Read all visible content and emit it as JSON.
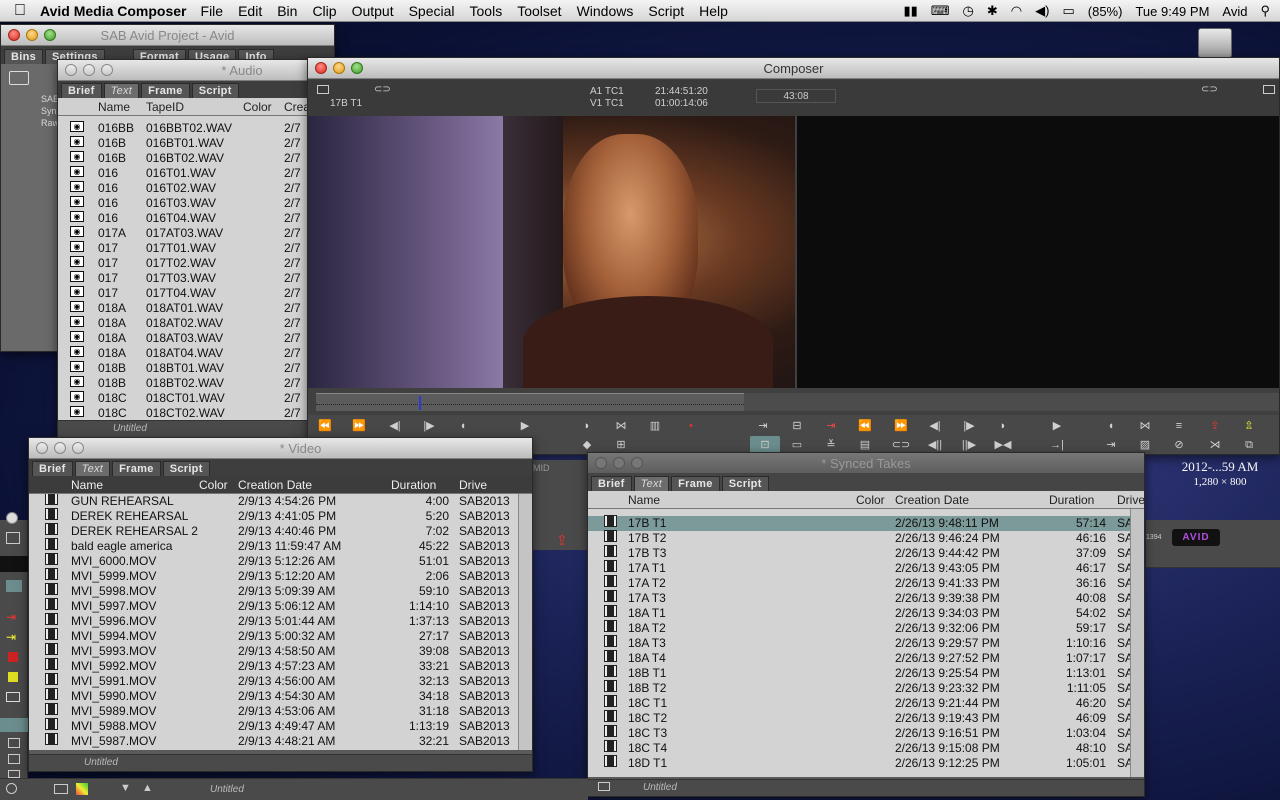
{
  "menubar": {
    "app_name": "Avid Media Composer",
    "menus": [
      "File",
      "Edit",
      "Bin",
      "Clip",
      "Output",
      "Special",
      "Tools",
      "Toolset",
      "Windows",
      "Script",
      "Help"
    ],
    "battery": "(85%)",
    "clock": "Tue 9:49 PM",
    "user": "Avid"
  },
  "project": {
    "title": "SAB Avid Project - Avid",
    "tabs": [
      "Bins",
      "Settings",
      "Format",
      "Usage",
      "Info"
    ],
    "items": [
      "SAB",
      "Syn",
      "Raw"
    ]
  },
  "audio_bin": {
    "title": "* Audio",
    "tabs": [
      "Brief",
      "Text",
      "Frame",
      "Script"
    ],
    "columns": [
      "Name",
      "TapeID",
      "Color",
      "Crea"
    ],
    "rows": [
      {
        "name": "016BB",
        "tape": "016BBT02.WAV",
        "date": "2/7"
      },
      {
        "name": "016B",
        "tape": "016BT01.WAV",
        "date": "2/7"
      },
      {
        "name": "016B",
        "tape": "016BT02.WAV",
        "date": "2/7"
      },
      {
        "name": "016",
        "tape": "016T01.WAV",
        "date": "2/7"
      },
      {
        "name": "016",
        "tape": "016T02.WAV",
        "date": "2/7"
      },
      {
        "name": "016",
        "tape": "016T03.WAV",
        "date": "2/7"
      },
      {
        "name": "016",
        "tape": "016T04.WAV",
        "date": "2/7"
      },
      {
        "name": "017A",
        "tape": "017AT03.WAV",
        "date": "2/7"
      },
      {
        "name": "017",
        "tape": "017T01.WAV",
        "date": "2/7"
      },
      {
        "name": "017",
        "tape": "017T02.WAV",
        "date": "2/7"
      },
      {
        "name": "017",
        "tape": "017T03.WAV",
        "date": "2/7"
      },
      {
        "name": "017",
        "tape": "017T04.WAV",
        "date": "2/7"
      },
      {
        "name": "018A",
        "tape": "018AT01.WAV",
        "date": "2/7"
      },
      {
        "name": "018A",
        "tape": "018AT02.WAV",
        "date": "2/7"
      },
      {
        "name": "018A",
        "tape": "018AT03.WAV",
        "date": "2/7"
      },
      {
        "name": "018A",
        "tape": "018AT04.WAV",
        "date": "2/7"
      },
      {
        "name": "018B",
        "tape": "018BT01.WAV",
        "date": "2/7"
      },
      {
        "name": "018B",
        "tape": "018BT02.WAV",
        "date": "2/7"
      },
      {
        "name": "018C",
        "tape": "018CT01.WAV",
        "date": "2/7"
      },
      {
        "name": "018C",
        "tape": "018CT02.WAV",
        "date": "2/7"
      }
    ],
    "footer": "Untitled"
  },
  "composer": {
    "title": "Composer",
    "clip": "17B T1",
    "tc_labels": [
      "A1 TC1",
      "V1 TC1"
    ],
    "tc_values": [
      "21:44:51:20",
      "01:00:14:06"
    ],
    "duration": "43:08"
  },
  "video_bin": {
    "title": "* Video",
    "tabs": [
      "Brief",
      "Text",
      "Frame",
      "Script"
    ],
    "columns": [
      "Name",
      "Color",
      "Creation Date",
      "Duration",
      "Drive"
    ],
    "rows": [
      {
        "name": "GUN REHEARSAL",
        "date": "2/9/13 4:54:26 PM",
        "dur": "4:00",
        "drive": "SAB2013"
      },
      {
        "name": "DEREK REHEARSAL",
        "date": "2/9/13 4:41:05 PM",
        "dur": "5:20",
        "drive": "SAB2013"
      },
      {
        "name": "DEREK REHEARSAL 2",
        "date": "2/9/13 4:40:46 PM",
        "dur": "7:02",
        "drive": "SAB2013"
      },
      {
        "name": "bald eagle america",
        "date": "2/9/13 11:59:47 AM",
        "dur": "45:22",
        "drive": "SAB2013"
      },
      {
        "name": "MVI_6000.MOV",
        "date": "2/9/13 5:12:26 AM",
        "dur": "51:01",
        "drive": "SAB2013"
      },
      {
        "name": "MVI_5999.MOV",
        "date": "2/9/13 5:12:20 AM",
        "dur": "2:06",
        "drive": "SAB2013"
      },
      {
        "name": "MVI_5998.MOV",
        "date": "2/9/13 5:09:39 AM",
        "dur": "59:10",
        "drive": "SAB2013"
      },
      {
        "name": "MVI_5997.MOV",
        "date": "2/9/13 5:06:12 AM",
        "dur": "1:14:10",
        "drive": "SAB2013"
      },
      {
        "name": "MVI_5996.MOV",
        "date": "2/9/13 5:01:44 AM",
        "dur": "1:37:13",
        "drive": "SAB2013"
      },
      {
        "name": "MVI_5994.MOV",
        "date": "2/9/13 5:00:32 AM",
        "dur": "27:17",
        "drive": "SAB2013"
      },
      {
        "name": "MVI_5993.MOV",
        "date": "2/9/13 4:58:50 AM",
        "dur": "39:08",
        "drive": "SAB2013"
      },
      {
        "name": "MVI_5992.MOV",
        "date": "2/9/13 4:57:23 AM",
        "dur": "33:21",
        "drive": "SAB2013"
      },
      {
        "name": "MVI_5991.MOV",
        "date": "2/9/13 4:56:00 AM",
        "dur": "32:13",
        "drive": "SAB2013"
      },
      {
        "name": "MVI_5990.MOV",
        "date": "2/9/13 4:54:30 AM",
        "dur": "34:18",
        "drive": "SAB2013"
      },
      {
        "name": "MVI_5989.MOV",
        "date": "2/9/13 4:53:06 AM",
        "dur": "31:18",
        "drive": "SAB2013"
      },
      {
        "name": "MVI_5988.MOV",
        "date": "2/9/13 4:49:47 AM",
        "dur": "1:13:19",
        "drive": "SAB2013"
      },
      {
        "name": "MVI_5987.MOV",
        "date": "2/9/13 4:48:21 AM",
        "dur": "32:21",
        "drive": "SAB2013"
      }
    ],
    "footer": "Untitled"
  },
  "synced_bin": {
    "title": "* Synced Takes",
    "tabs": [
      "Brief",
      "Text",
      "Frame",
      "Script"
    ],
    "columns": [
      "Name",
      "Color",
      "Creation Date",
      "Duration",
      "Drive"
    ],
    "rows": [
      {
        "name": "17B T1",
        "date": "2/26/13 9:48:11 PM",
        "dur": "57:14",
        "drive": "SA",
        "selected": true
      },
      {
        "name": "17B T2",
        "date": "2/26/13 9:46:24 PM",
        "dur": "46:16",
        "drive": "SA"
      },
      {
        "name": "17B T3",
        "date": "2/26/13 9:44:42 PM",
        "dur": "37:09",
        "drive": "SA"
      },
      {
        "name": "17A T1",
        "date": "2/26/13 9:43:05 PM",
        "dur": "46:17",
        "drive": "SA"
      },
      {
        "name": "17A T2",
        "date": "2/26/13 9:41:33 PM",
        "dur": "36:16",
        "drive": "SA"
      },
      {
        "name": "17A T3",
        "date": "2/26/13 9:39:38 PM",
        "dur": "40:08",
        "drive": "SA"
      },
      {
        "name": "18A T1",
        "date": "2/26/13 9:34:03 PM",
        "dur": "54:02",
        "drive": "SA"
      },
      {
        "name": "18A T2",
        "date": "2/26/13 9:32:06 PM",
        "dur": "59:17",
        "drive": "SA"
      },
      {
        "name": "18A T3",
        "date": "2/26/13 9:29:57 PM",
        "dur": "1:10:16",
        "drive": "SA"
      },
      {
        "name": "18A T4",
        "date": "2/26/13 9:27:52 PM",
        "dur": "1:07:17",
        "drive": "SA"
      },
      {
        "name": "18B T1",
        "date": "2/26/13 9:25:54 PM",
        "dur": "1:13:01",
        "drive": "SA"
      },
      {
        "name": "18B T2",
        "date": "2/26/13 9:23:32 PM",
        "dur": "1:11:05",
        "drive": "SA"
      },
      {
        "name": "18C T1",
        "date": "2/26/13 9:21:44 PM",
        "dur": "46:20",
        "drive": "SA"
      },
      {
        "name": "18C T2",
        "date": "2/26/13 9:19:43 PM",
        "dur": "46:09",
        "drive": "SA"
      },
      {
        "name": "18C T3",
        "date": "2/26/13 9:16:51 PM",
        "dur": "1:03:04",
        "drive": "SA"
      },
      {
        "name": "18C T4",
        "date": "2/26/13 9:15:08 PM",
        "dur": "48:10",
        "drive": "SA"
      },
      {
        "name": "18D T1",
        "date": "2/26/13 9:12:25 PM",
        "dur": "1:05:01",
        "drive": "SA"
      }
    ],
    "footer": "Untitled"
  },
  "desktop": {
    "screenshot_name": "2012-...59 AM",
    "screenshot_size": "1,280 × 800",
    "mid_label": "MID",
    "badge_1394": "1394",
    "avid_logo": "AVID"
  },
  "bottom_footer": "Untitled",
  "colors": {
    "selection": "#7c9a99",
    "bin_bg": "#d3d3d3",
    "accent_red": "#c0302a"
  }
}
